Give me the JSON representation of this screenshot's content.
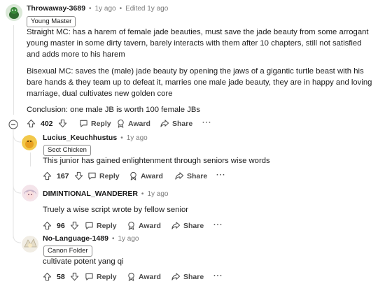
{
  "main_comment": {
    "username": "Throwaway-3689",
    "time": "1y ago",
    "edited": "Edited 1y ago",
    "flair": "Young Master",
    "paragraphs": [
      "Straight MC: has a harem of female jade beauties, must save the jade beauty from some arrogant young master in some dirty tavern, barely interacts with them after 10 chapters, still not satisfied and adds more to his harem",
      "Bisexual MC: saves the (male) jade beauty by opening the jaws of a gigantic turtle beast with his bare hands & they team up to defeat it, marries one male jade beauty, they are in happy and loving marriage, dual cultivates new golden core",
      "Conclusion: one male JB is worth 100 female JBs"
    ],
    "votes": "402",
    "reply_label": "Reply",
    "award_label": "Award",
    "share_label": "Share",
    "more_label": "···"
  },
  "replies": [
    {
      "username": "Lucius_Keuchhustus",
      "time": "1y ago",
      "flair": "Sect Chicken",
      "text": "This junior has gained enlightenment through seniors wise words",
      "votes": "167",
      "reply_label": "Reply",
      "award_label": "Award",
      "share_label": "Share",
      "more_label": "···"
    },
    {
      "username": "DIMINTIONAL_WANDERER",
      "time": "1y ago",
      "text": "Truely a wise script wrote by fellow senior",
      "votes": "96",
      "reply_label": "Reply",
      "award_label": "Award",
      "share_label": "Share",
      "more_label": "···"
    },
    {
      "username": "No-Language-1489",
      "time": "1y ago",
      "flair": "Canon Folder",
      "text": "cultivate potent yang qi",
      "votes": "58",
      "reply_label": "Reply",
      "award_label": "Award",
      "share_label": "Share",
      "more_label": "···"
    }
  ],
  "separator": "•",
  "colors": {
    "text": "#1c1c1c",
    "meta": "#7c7c7c",
    "thread_line": "#e3e3e3"
  }
}
